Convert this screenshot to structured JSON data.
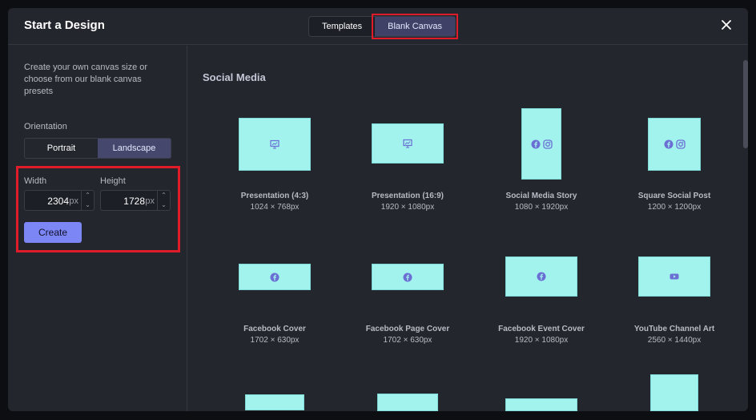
{
  "header": {
    "title": "Start a Design",
    "tabs": [
      {
        "label": "Templates",
        "active": false
      },
      {
        "label": "Blank Canvas",
        "active": true
      }
    ],
    "close_icon": "close-icon"
  },
  "sidebar": {
    "description": "Create your own canvas size or choose from our blank canvas presets",
    "orientation_label": "Orientation",
    "orientation_options": [
      "Portrait",
      "Landscape"
    ],
    "orientation_selected": "Landscape",
    "width_label": "Width",
    "width_value": "2304",
    "height_label": "Height",
    "height_value": "1728",
    "unit": "px",
    "create_label": "Create"
  },
  "main": {
    "section_title": "Social Media",
    "presets": [
      {
        "name": "Presentation (4:3)",
        "size": "1024 × 768px",
        "icon": "presentation-icon"
      },
      {
        "name": "Presentation (16:9)",
        "size": "1920 × 1080px",
        "icon": "presentation-icon"
      },
      {
        "name": "Social Media Story",
        "size": "1080 × 1920px",
        "icon": "facebook-instagram-icons"
      },
      {
        "name": "Square Social Post",
        "size": "1200 × 1200px",
        "icon": "facebook-instagram-icons"
      },
      {
        "name": "Facebook Cover",
        "size": "1702 × 630px",
        "icon": "facebook-icon"
      },
      {
        "name": "Facebook Page Cover",
        "size": "1702 × 630px",
        "icon": "facebook-icon"
      },
      {
        "name": "Facebook Event Cover",
        "size": "1920 × 1080px",
        "icon": "facebook-icon"
      },
      {
        "name": "YouTube Channel Art",
        "size": "2560 × 1440px",
        "icon": "youtube-icon"
      }
    ]
  },
  "colors": {
    "accent": "#7d86f5",
    "thumb_fill": "#a2f2ee",
    "highlight": "#e01c2a",
    "background": "#24262e"
  }
}
